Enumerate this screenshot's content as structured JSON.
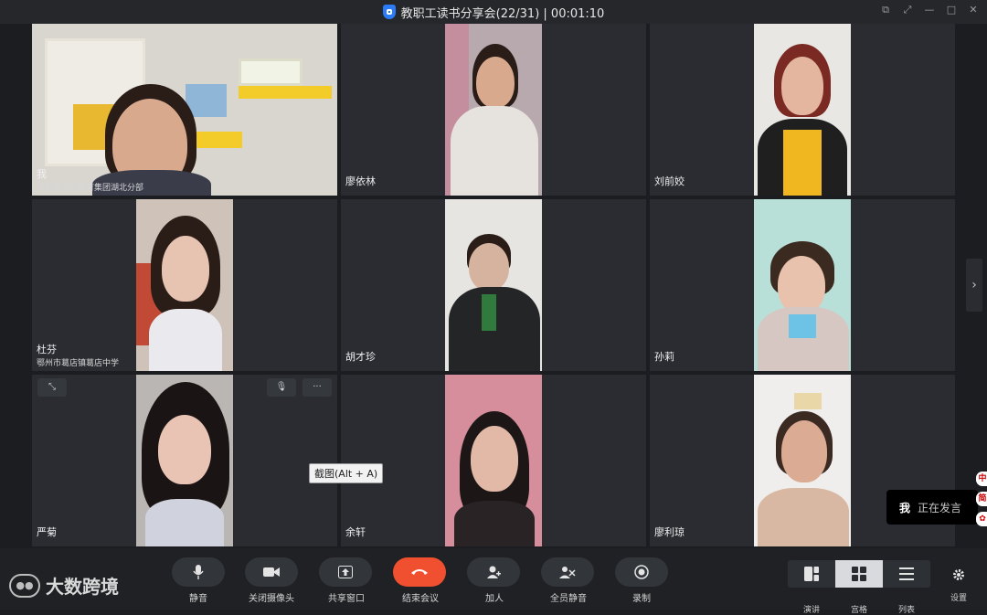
{
  "window": {
    "title": "教职工读书分享会(22/31) | 00:01:10"
  },
  "participants": [
    {
      "name": "我",
      "org": "深圳阳光花教育集团湖北分部"
    },
    {
      "name": "廖依林",
      "org": ""
    },
    {
      "name": "刘前姣",
      "org": ""
    },
    {
      "name": "杜芬",
      "org": "鄂州市葛店镇葛店中学"
    },
    {
      "name": "胡才珍",
      "org": ""
    },
    {
      "name": "孙莉",
      "org": ""
    },
    {
      "name": "严菊",
      "org": ""
    },
    {
      "name": "余轩",
      "org": ""
    },
    {
      "name": "廖利琼",
      "org": ""
    }
  ],
  "tooltip": {
    "text": "截图(Alt + A)"
  },
  "speaking": {
    "who": "我",
    "status": "正在发言"
  },
  "side_badges": [
    "中",
    "简",
    "✿"
  ],
  "toolbar": {
    "mute": "静音",
    "camera_off": "关闭摄像头",
    "share": "共享窗口",
    "end": "结束会议",
    "invite": "加人",
    "mute_all": "全员静音",
    "record": "录制",
    "view_speaker": "演讲",
    "view_grid": "宫格",
    "view_list": "列表",
    "settings": "设置"
  },
  "watermark": "大数跨境",
  "colors": {
    "accent": "#2fa84f",
    "end_call": "#f0502f",
    "brand_blue": "#2b7cf6"
  }
}
